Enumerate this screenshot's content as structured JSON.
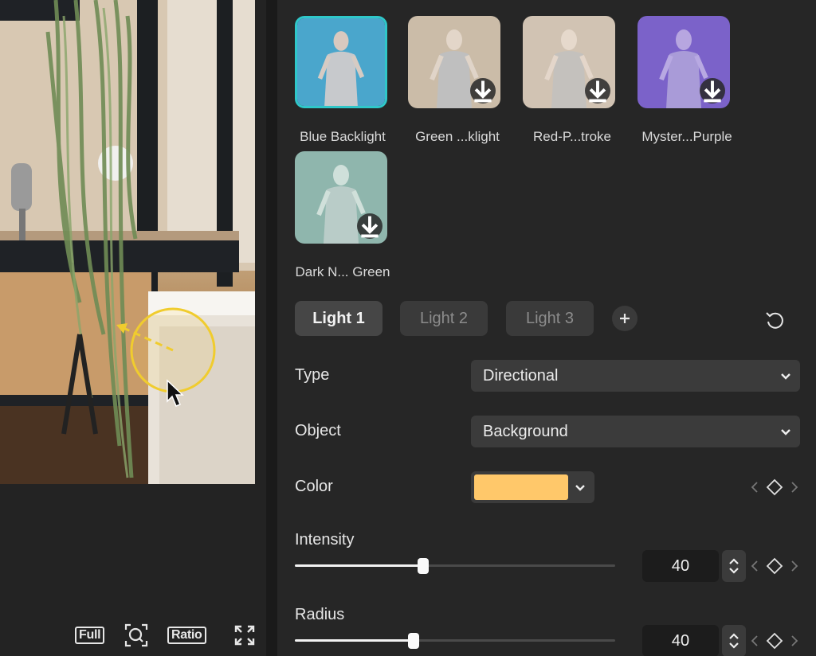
{
  "preview": {
    "view_buttons": {
      "full": "Full",
      "ratio": "Ratio"
    }
  },
  "presets": [
    {
      "name": "Blue Backlight",
      "selected": true,
      "downloadable": false,
      "tint": "#5ab4d6"
    },
    {
      "name": "Green ...klight",
      "selected": false,
      "downloadable": true,
      "tint": "#c9bba6"
    },
    {
      "name": "Red-P...troke",
      "selected": false,
      "downloadable": true,
      "tint": "#cdbfae"
    },
    {
      "name": "Myster...Purple",
      "selected": false,
      "downloadable": true,
      "tint": "#7a63c8"
    },
    {
      "name": "Dark N... Green",
      "selected": false,
      "downloadable": true,
      "tint": "#8fb6ad"
    }
  ],
  "lights": {
    "tabs": [
      "Light 1",
      "Light 2",
      "Light 3"
    ],
    "active": "Light 1"
  },
  "fields": {
    "type": {
      "label": "Type",
      "value": "Directional"
    },
    "object": {
      "label": "Object",
      "value": "Background"
    },
    "color": {
      "label": "Color",
      "value": "#ffc86a"
    },
    "intensity": {
      "label": "Intensity",
      "value": "40",
      "slider_fraction": 0.4
    },
    "radius": {
      "label": "Radius",
      "value": "40",
      "slider_fraction": 0.37
    }
  },
  "icons": {
    "add": "plus-icon",
    "reset": "reset-icon",
    "download": "download-icon",
    "keyframe": "diamond-icon",
    "zoom": "zoom-icon",
    "fullscreen": "fullscreen-icon"
  }
}
